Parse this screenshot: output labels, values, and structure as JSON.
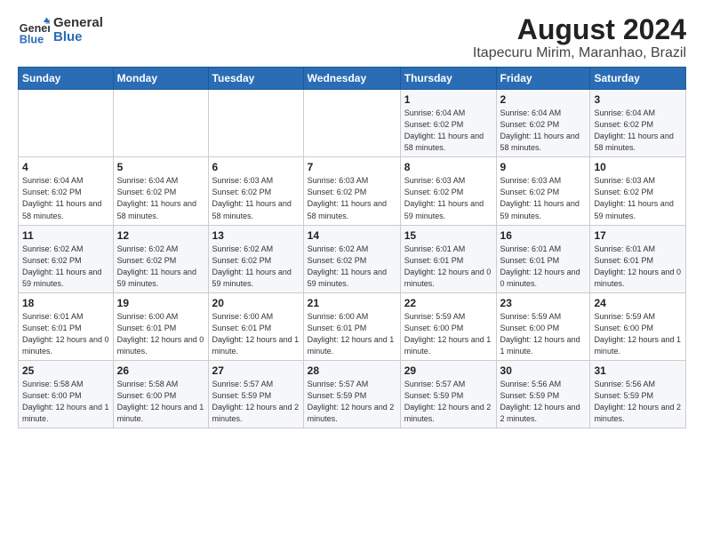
{
  "logo": {
    "line1": "General",
    "line2": "Blue"
  },
  "title": "August 2024",
  "subtitle": "Itapecuru Mirim, Maranhao, Brazil",
  "weekdays": [
    "Sunday",
    "Monday",
    "Tuesday",
    "Wednesday",
    "Thursday",
    "Friday",
    "Saturday"
  ],
  "weeks": [
    [
      {
        "day": "",
        "info": ""
      },
      {
        "day": "",
        "info": ""
      },
      {
        "day": "",
        "info": ""
      },
      {
        "day": "",
        "info": ""
      },
      {
        "day": "1",
        "info": "Sunrise: 6:04 AM\nSunset: 6:02 PM\nDaylight: 11 hours\nand 58 minutes."
      },
      {
        "day": "2",
        "info": "Sunrise: 6:04 AM\nSunset: 6:02 PM\nDaylight: 11 hours\nand 58 minutes."
      },
      {
        "day": "3",
        "info": "Sunrise: 6:04 AM\nSunset: 6:02 PM\nDaylight: 11 hours\nand 58 minutes."
      }
    ],
    [
      {
        "day": "4",
        "info": "Sunrise: 6:04 AM\nSunset: 6:02 PM\nDaylight: 11 hours\nand 58 minutes."
      },
      {
        "day": "5",
        "info": "Sunrise: 6:04 AM\nSunset: 6:02 PM\nDaylight: 11 hours\nand 58 minutes."
      },
      {
        "day": "6",
        "info": "Sunrise: 6:03 AM\nSunset: 6:02 PM\nDaylight: 11 hours\nand 58 minutes."
      },
      {
        "day": "7",
        "info": "Sunrise: 6:03 AM\nSunset: 6:02 PM\nDaylight: 11 hours\nand 58 minutes."
      },
      {
        "day": "8",
        "info": "Sunrise: 6:03 AM\nSunset: 6:02 PM\nDaylight: 11 hours\nand 59 minutes."
      },
      {
        "day": "9",
        "info": "Sunrise: 6:03 AM\nSunset: 6:02 PM\nDaylight: 11 hours\nand 59 minutes."
      },
      {
        "day": "10",
        "info": "Sunrise: 6:03 AM\nSunset: 6:02 PM\nDaylight: 11 hours\nand 59 minutes."
      }
    ],
    [
      {
        "day": "11",
        "info": "Sunrise: 6:02 AM\nSunset: 6:02 PM\nDaylight: 11 hours\nand 59 minutes."
      },
      {
        "day": "12",
        "info": "Sunrise: 6:02 AM\nSunset: 6:02 PM\nDaylight: 11 hours\nand 59 minutes."
      },
      {
        "day": "13",
        "info": "Sunrise: 6:02 AM\nSunset: 6:02 PM\nDaylight: 11 hours\nand 59 minutes."
      },
      {
        "day": "14",
        "info": "Sunrise: 6:02 AM\nSunset: 6:02 PM\nDaylight: 11 hours\nand 59 minutes."
      },
      {
        "day": "15",
        "info": "Sunrise: 6:01 AM\nSunset: 6:01 PM\nDaylight: 12 hours\nand 0 minutes."
      },
      {
        "day": "16",
        "info": "Sunrise: 6:01 AM\nSunset: 6:01 PM\nDaylight: 12 hours\nand 0 minutes."
      },
      {
        "day": "17",
        "info": "Sunrise: 6:01 AM\nSunset: 6:01 PM\nDaylight: 12 hours\nand 0 minutes."
      }
    ],
    [
      {
        "day": "18",
        "info": "Sunrise: 6:01 AM\nSunset: 6:01 PM\nDaylight: 12 hours\nand 0 minutes."
      },
      {
        "day": "19",
        "info": "Sunrise: 6:00 AM\nSunset: 6:01 PM\nDaylight: 12 hours\nand 0 minutes."
      },
      {
        "day": "20",
        "info": "Sunrise: 6:00 AM\nSunset: 6:01 PM\nDaylight: 12 hours\nand 1 minute."
      },
      {
        "day": "21",
        "info": "Sunrise: 6:00 AM\nSunset: 6:01 PM\nDaylight: 12 hours\nand 1 minute."
      },
      {
        "day": "22",
        "info": "Sunrise: 5:59 AM\nSunset: 6:00 PM\nDaylight: 12 hours\nand 1 minute."
      },
      {
        "day": "23",
        "info": "Sunrise: 5:59 AM\nSunset: 6:00 PM\nDaylight: 12 hours\nand 1 minute."
      },
      {
        "day": "24",
        "info": "Sunrise: 5:59 AM\nSunset: 6:00 PM\nDaylight: 12 hours\nand 1 minute."
      }
    ],
    [
      {
        "day": "25",
        "info": "Sunrise: 5:58 AM\nSunset: 6:00 PM\nDaylight: 12 hours\nand 1 minute."
      },
      {
        "day": "26",
        "info": "Sunrise: 5:58 AM\nSunset: 6:00 PM\nDaylight: 12 hours\nand 1 minute."
      },
      {
        "day": "27",
        "info": "Sunrise: 5:57 AM\nSunset: 5:59 PM\nDaylight: 12 hours\nand 2 minutes."
      },
      {
        "day": "28",
        "info": "Sunrise: 5:57 AM\nSunset: 5:59 PM\nDaylight: 12 hours\nand 2 minutes."
      },
      {
        "day": "29",
        "info": "Sunrise: 5:57 AM\nSunset: 5:59 PM\nDaylight: 12 hours\nand 2 minutes."
      },
      {
        "day": "30",
        "info": "Sunrise: 5:56 AM\nSunset: 5:59 PM\nDaylight: 12 hours\nand 2 minutes."
      },
      {
        "day": "31",
        "info": "Sunrise: 5:56 AM\nSunset: 5:59 PM\nDaylight: 12 hours\nand 2 minutes."
      }
    ]
  ]
}
